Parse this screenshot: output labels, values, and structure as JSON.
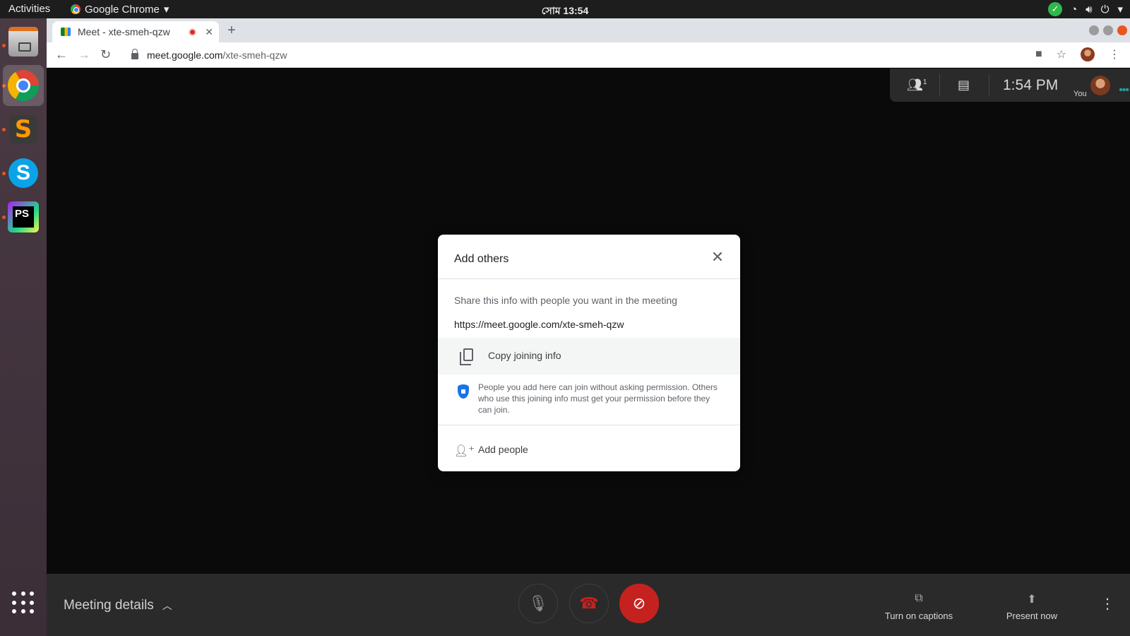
{
  "topbar": {
    "activities": "Activities",
    "app_name": "Google Chrome",
    "clock": "সোম 13:54"
  },
  "dock": {
    "items": [
      "files",
      "chrome",
      "sublime-text",
      "skype",
      "phpstorm",
      "show-applications"
    ]
  },
  "browser": {
    "tab_title": "Meet - xte-smeh-qzw",
    "url_domain": "meet.google.com",
    "url_path": "/xte-smeh-qzw"
  },
  "meet": {
    "participants_count": "1",
    "time": "1:54 PM",
    "self_label": "You"
  },
  "dialog": {
    "title": "Add others",
    "share_text": "Share this info with people you want in the meeting",
    "meeting_url": "https://meet.google.com/xte-smeh-qzw",
    "copy_label": "Copy joining info",
    "note": "People you add here can join without asking permission. Others who use this joining info must get your permission before they can join.",
    "add_people": "Add people"
  },
  "bottombar": {
    "meeting_details": "Meeting details",
    "captions": "Turn on captions",
    "present": "Present now"
  },
  "colors": {
    "accent_blue": "#1a73e8",
    "hangup_red": "#c5221f",
    "ubuntu_orange": "#e95420"
  }
}
